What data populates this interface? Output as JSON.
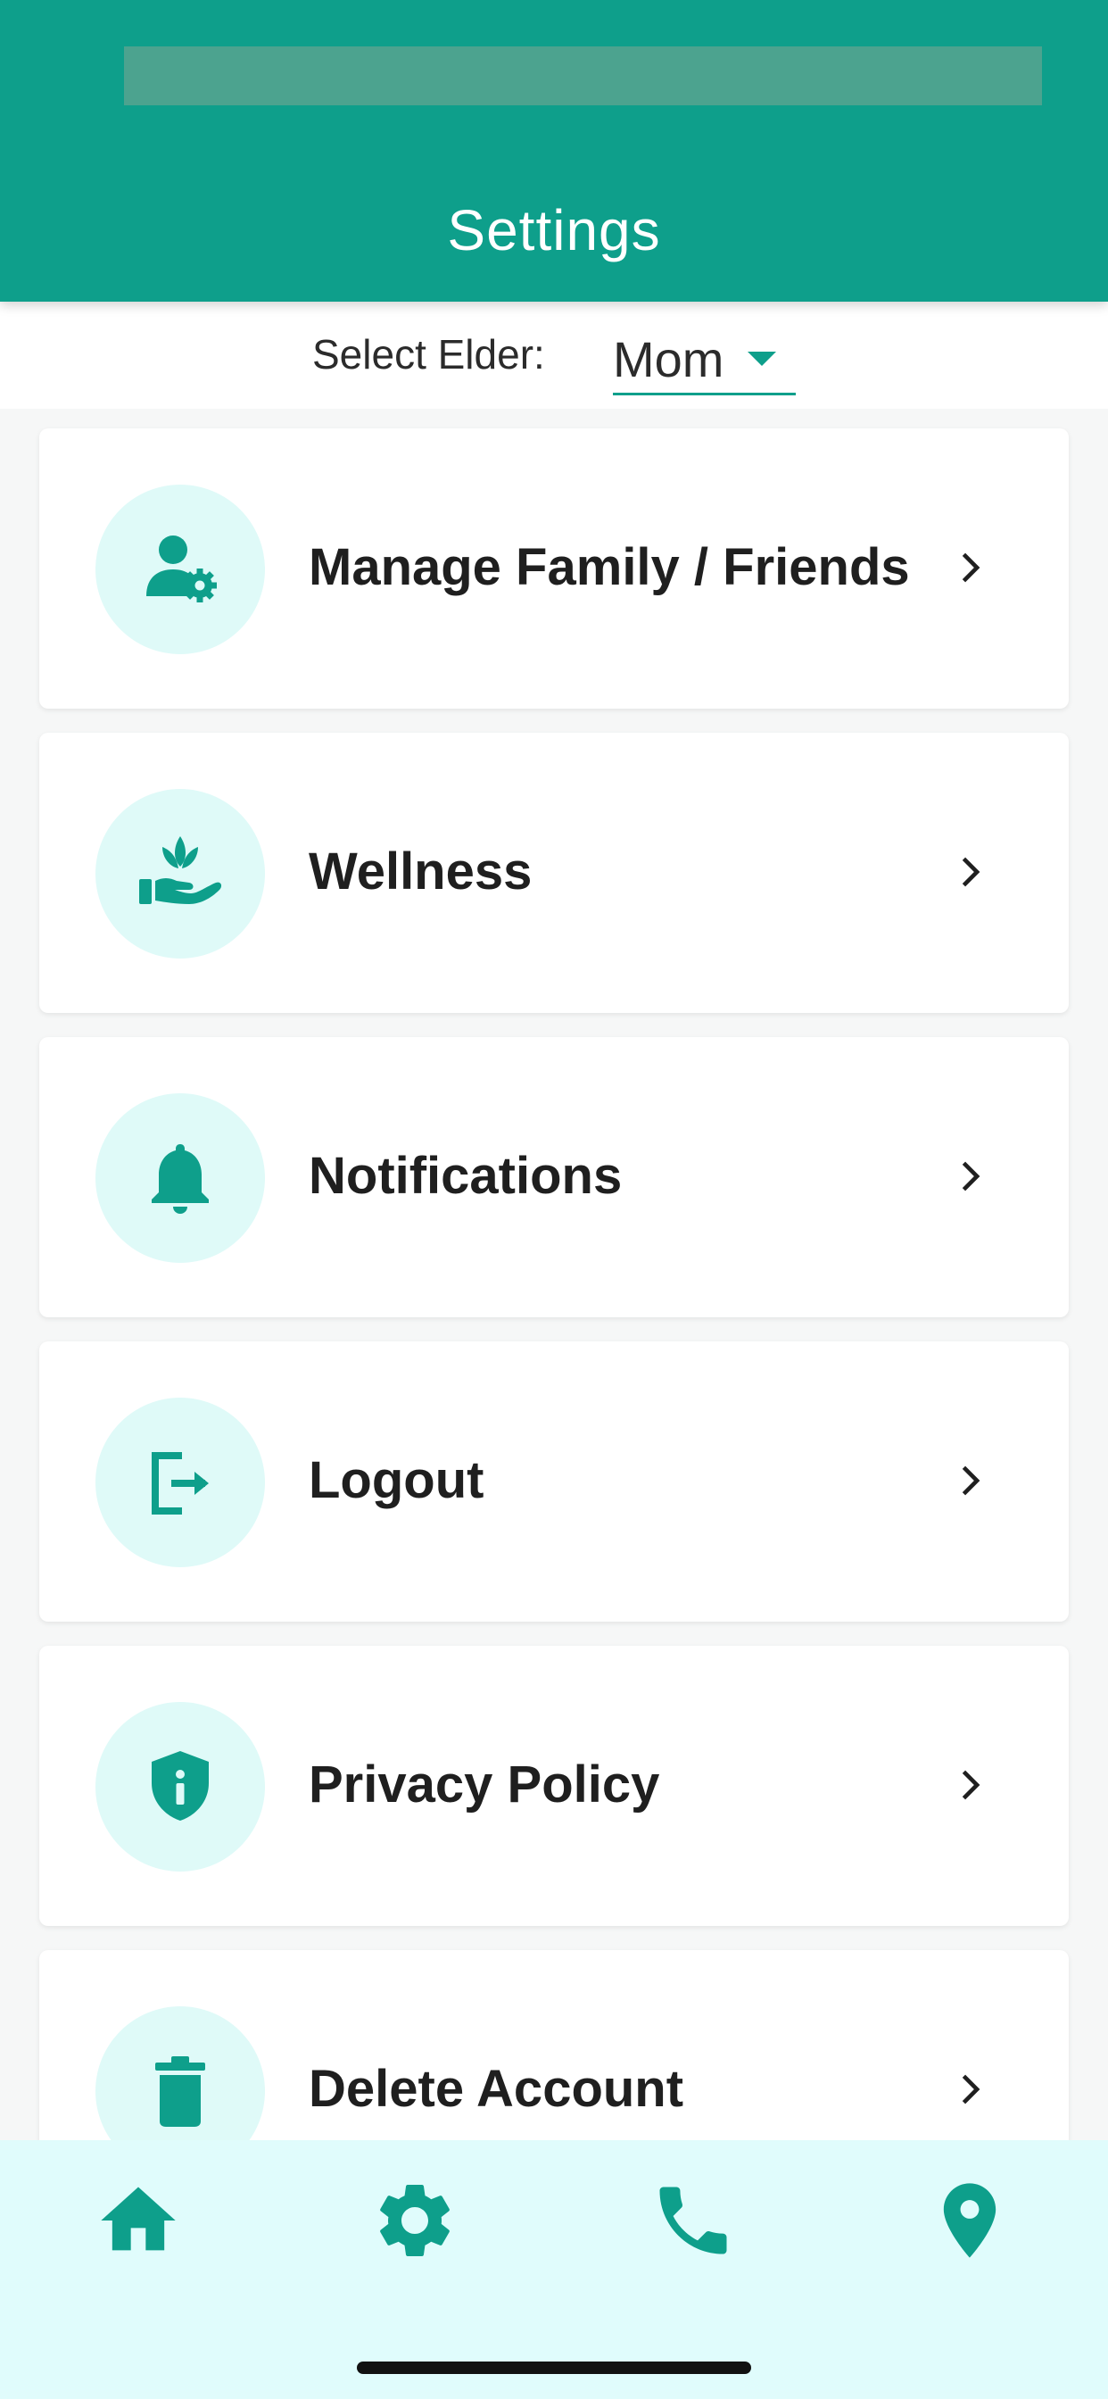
{
  "header": {
    "title": "Settings"
  },
  "elder_selector": {
    "label": "Select Elder:",
    "value": "Mom"
  },
  "settings_items": [
    {
      "label": "Manage Family / Friends",
      "icon": "user-gear-icon"
    },
    {
      "label": "Wellness",
      "icon": "hand-lotus-icon"
    },
    {
      "label": "Notifications",
      "icon": "bell-icon"
    },
    {
      "label": "Logout",
      "icon": "logout-icon"
    },
    {
      "label": "Privacy Policy",
      "icon": "shield-info-icon"
    },
    {
      "label": "Delete Account",
      "icon": "trash-icon"
    }
  ],
  "bottom_nav": [
    {
      "name": "home",
      "icon": "home-icon"
    },
    {
      "name": "settings",
      "icon": "gear-icon"
    },
    {
      "name": "call",
      "icon": "phone-icon"
    },
    {
      "name": "location",
      "icon": "location-pin-icon"
    }
  ],
  "colors": {
    "primary": "#0e9f8b",
    "icon_bg": "#dffaf8",
    "nav_bg": "#e0fcfc"
  }
}
